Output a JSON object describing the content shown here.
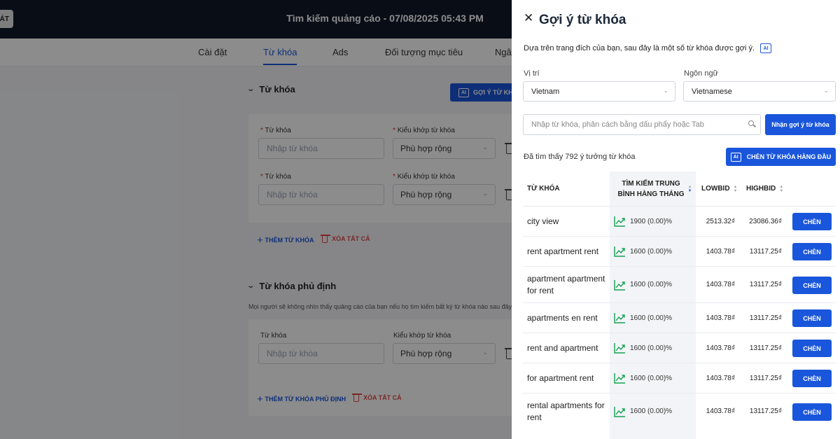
{
  "header": {
    "back_label": "ÁT",
    "title": "Tìm kiếm quảng cáo - 07/08/2025 05:43 PM"
  },
  "tabs": [
    {
      "label": "Cài đặt",
      "active": false
    },
    {
      "label": "Từ khóa",
      "active": true
    },
    {
      "label": "Ads",
      "active": false
    },
    {
      "label": "Đối tượng mục tiêu",
      "active": false
    },
    {
      "label": "Ngâ",
      "active": false
    }
  ],
  "keywords_section": {
    "title": "Từ khóa",
    "ai_button_label": "GỢI Ý TỪ KHÓ",
    "rows": [
      {
        "keyword_label": "Từ khóa",
        "keyword_placeholder": "Nhập từ khóa",
        "match_label": "Kiểu khớp từ khóa",
        "match_value": "Phù hợp rộng"
      },
      {
        "keyword_label": "Từ khóa",
        "keyword_placeholder": "Nhập từ khóa",
        "match_label": "Kiểu khớp từ khóa",
        "match_value": "Phù hợp rộng"
      }
    ],
    "add_label": "THÊM TỪ KHÓA",
    "clear_label": "XÓA TẤT CẢ"
  },
  "negative_section": {
    "title": "Từ khóa phủ định",
    "hint": "Mọi người sẽ không nhìn thấy quảng cáo của bạn nếu họ tìm kiếm bất kỳ từ khóa nào sau đây.",
    "keyword_label": "Từ khóa",
    "keyword_placeholder": "Nhập từ khóa",
    "match_label": "Kiểu khớp từ khóa",
    "match_value": "Phù hợp rộng",
    "add_label": "THÊM TỪ KHÓA PHỦ ĐỊNH",
    "clear_label": "XÓA TẤT CẢ"
  },
  "drawer": {
    "close_icon": "close-icon",
    "title": "Gợi ý từ khóa",
    "subtitle": "Dựa trên trang đích của bạn, sau đây là một số từ khóa được gợi ý.",
    "ai_icon_text": "AI",
    "location_label": "Vị trí",
    "location_value": "Vietnam",
    "language_label": "Ngôn ngữ",
    "language_value": "Vietnamese",
    "search_placeholder": "Nhập từ khóa, phân cách bằng dấu phẩy hoặc Tab",
    "suggest_button": "Nhận gợi ý từ khóa",
    "found_text": "Đã tìm thấy 792 ý tưởng từ khóa",
    "insert_top_button": "CHÈN TỪ KHÓA HÀNG ĐẦU",
    "table": {
      "headers": {
        "keyword": "TỪ KHÓA",
        "searches_line1": "TÌM KIẾM TRUNG",
        "searches_line2": "BÌNH HÀNG THÁNG",
        "lowbid": "LOWBID",
        "highbid": "HIGHBID"
      },
      "insert_label": "CHÈN",
      "rows": [
        {
          "keyword": "city view",
          "searches": "1900 (0.00)%",
          "lowbid": "2513.32₫",
          "highbid": "23086.36₫"
        },
        {
          "keyword": "rent apartment rent",
          "searches": "1600 (0.00)%",
          "lowbid": "1403.78₫",
          "highbid": "13117.25₫"
        },
        {
          "keyword": "apartment apartment for rent",
          "searches": "1600 (0.00)%",
          "lowbid": "1403.78₫",
          "highbid": "13117.25₫"
        },
        {
          "keyword": "apartments en rent",
          "searches": "1600 (0.00)%",
          "lowbid": "1403.78₫",
          "highbid": "13117.25₫"
        },
        {
          "keyword": "rent and apartment",
          "searches": "1600 (0.00)%",
          "lowbid": "1403.78₫",
          "highbid": "13117.25₫"
        },
        {
          "keyword": "for apartment rent",
          "searches": "1600 (0.00)%",
          "lowbid": "1403.78₫",
          "highbid": "13117.25₫"
        },
        {
          "keyword": "rental apartments for rent",
          "searches": "1600 (0.00)%",
          "lowbid": "1403.78₫",
          "highbid": "13117.25₫"
        }
      ]
    }
  },
  "colors": {
    "primary": "#1a56db",
    "header_bg": "#101828",
    "danger": "#e04848",
    "trend_green": "#12a150"
  }
}
